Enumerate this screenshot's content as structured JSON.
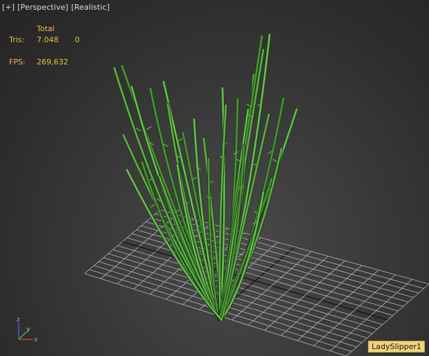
{
  "viewport": {
    "menu": {
      "plus": "[+]",
      "view": "[Perspective]",
      "shading": "[Realistic]"
    },
    "stats": {
      "column_header": "Total",
      "tris_label": "Tris:",
      "tris_total": "7.048",
      "tris_selected": "0",
      "fps_label": "FPS:",
      "fps_value": "269,632"
    },
    "axis_gizmo": {
      "x": "x",
      "y": "y",
      "z": "z"
    },
    "object_label": "LadySlipper1"
  },
  "colors": {
    "stats_text": "#e8c23a",
    "grid_lines": "#bfbfbf",
    "plant_green": "#4f9a3a",
    "label_background": "#f2d27a"
  }
}
